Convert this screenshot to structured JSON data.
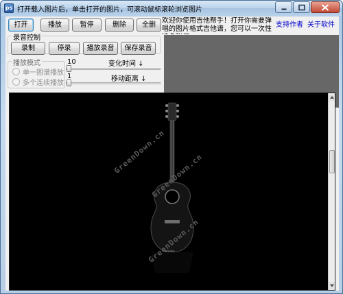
{
  "window": {
    "title": "打开载入图片后，单击打开的图片，可滚动鼠标滚轮浏览图片",
    "icon_label": "ps"
  },
  "toolbar": {
    "open_label": "打开",
    "play_label": "播放",
    "pause_label": "暂停",
    "delete_label": "删除",
    "delete_all_label": "全删"
  },
  "tip_text": "欢迎你使用吉他帮手！打开你需要弹唱的图片格式吉他谱，您可以一次性选多张打",
  "links": {
    "support_author": "支持作者",
    "about": "关于软件"
  },
  "record_group": {
    "title": "录音控制",
    "record_label": "录制",
    "stop_record_label": "停录",
    "play_recording_label": "播放录音",
    "save_recording_label": "保存录音"
  },
  "play_mode_group": {
    "title": "播放模式",
    "options": [
      "单一图谱播放",
      "多个连续播放"
    ]
  },
  "params": {
    "change_time_value": "10",
    "change_time_label": "变化时间 ↓",
    "move_distance_value": "1",
    "move_distance_label": "移动距离 ↓"
  },
  "viewer": {
    "watermarks": [
      "GreenDown.cn",
      "GreenDown.cn",
      "GreenDown.cn"
    ]
  },
  "colors": {
    "viewer_bg": "#000000",
    "link": "#0000cc",
    "dark_panel": "#676767"
  }
}
